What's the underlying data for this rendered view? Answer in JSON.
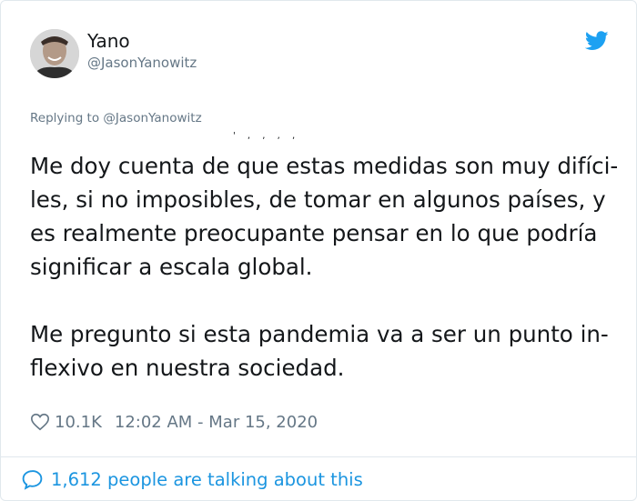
{
  "author": {
    "name": "Yano",
    "handle": "@JasonYanowitz",
    "avatar_icon": "profile-photo"
  },
  "reply": {
    "text": "Replying to @JasonYanowitz"
  },
  "tweet": {
    "clipped_top": "' , , , ,",
    "paragraphs": [
      "Me doy cuenta de que estas medidas son muy difíci-les, si no imposibles, de tomar en algunos países, y es realmente preocupante pensar en lo que podría significar a escala global.",
      "Me pregunto si esta pandemia va a ser un punto in-flexivo en nuestra sociedad."
    ]
  },
  "meta": {
    "likes": "10.1K",
    "timestamp": "12:02 AM - Mar 15, 2020"
  },
  "footer": {
    "talking": "1,612 people are talking about this"
  },
  "colors": {
    "twitter_blue": "#1da1f2",
    "link_blue": "#1b95e0",
    "secondary_text": "#657786",
    "border": "#e1e8ed"
  }
}
